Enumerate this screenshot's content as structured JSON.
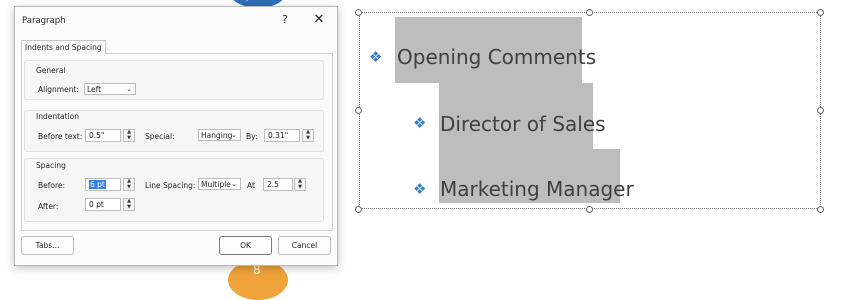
{
  "decor": {
    "top_badge": "√",
    "bottom_badge": "8"
  },
  "dialog": {
    "title": "Paragraph",
    "help": "?",
    "close": "✕",
    "tab": "Indents and Spacing",
    "general": {
      "header": "General",
      "alignment_label": "Alignment:",
      "alignment_value": "Left"
    },
    "indentation": {
      "header": "Indentation",
      "before_text_label": "Before text:",
      "before_text_value": "0.5\"",
      "special_label": "Special:",
      "special_value": "Hanging",
      "by_label": "By:",
      "by_value": "0.31\""
    },
    "spacing": {
      "header": "Spacing",
      "before_label": "Before:",
      "before_value": "6 pt",
      "line_spacing_label": "Line Spacing:",
      "line_spacing_value": "Multiple",
      "at_label": "At",
      "at_value": "2.5",
      "after_label": "After:",
      "after_value": "0 pt"
    },
    "buttons": {
      "tabs": "Tabs...",
      "ok": "OK",
      "cancel": "Cancel"
    }
  },
  "slide": {
    "bullets": [
      {
        "text": "Opening Comments",
        "symbol": "❖"
      },
      {
        "text": "Director of Sales",
        "symbol": "❖"
      },
      {
        "text": "Marketing Manager",
        "symbol": "❖"
      }
    ],
    "bullet_color": "#3f7fc0",
    "highlight_color": "#bdbdbd"
  }
}
